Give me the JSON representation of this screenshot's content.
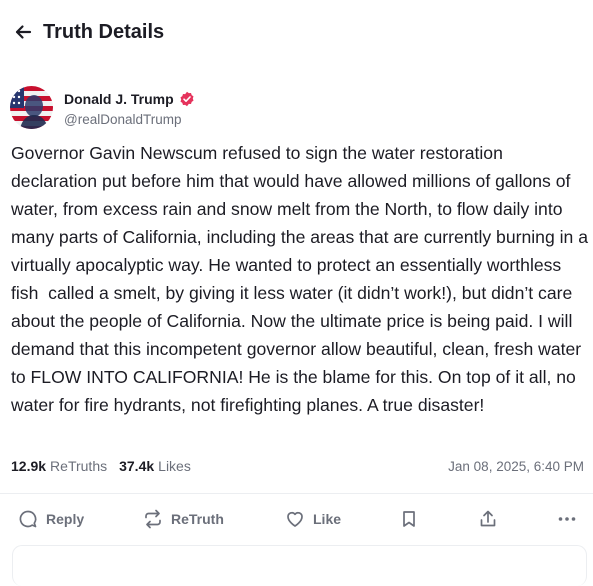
{
  "header": {
    "title": "Truth Details",
    "back_icon": "arrow-left-icon"
  },
  "author": {
    "name": "Donald J. Trump",
    "handle": "@realDonaldTrump",
    "verified_color": "#e5335c",
    "avatar_icon": "avatar-flag-portrait"
  },
  "post": {
    "text": "Governor Gavin Newscum refused to sign the water restoration declaration put before him that would have allowed millions of gallons of water, from excess rain and snow melt from the North, to flow daily into many parts of California, including the areas that are currently burning in a virtually apocalyptic way. He wanted to protect an essentially worthless fish  called a smelt, by giving it less water (it didn’t work!), but didn’t care about the people of California. Now the ultimate price is being paid. I will demand that this incompetent governor allow beautiful, clean, fresh water to FLOW INTO CALIFORNIA! He is the blame for this. On top of it all, no water for fire hydrants, not firefighting planes. A true disaster!"
  },
  "stats": {
    "retruths_count": "12.9k",
    "retruths_label": "ReTruths",
    "likes_count": "37.4k",
    "likes_label": "Likes",
    "date": "Jan 08, 2025, 6:40 PM"
  },
  "actions": {
    "reply_label": "Reply",
    "retruth_label": "ReTruth",
    "like_label": "Like",
    "icons": [
      "reply-icon",
      "retruth-icon",
      "like-icon",
      "bookmark-icon",
      "share-icon",
      "more-icon"
    ]
  }
}
